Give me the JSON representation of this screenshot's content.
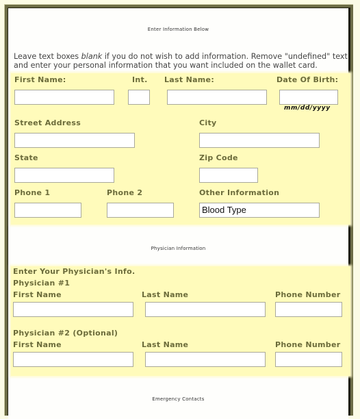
{
  "sections": {
    "personal_title": "Enter Information Below",
    "physician_title": "Physician Information",
    "emergency_title": "Emergency Contacts"
  },
  "intro": {
    "before": "Leave text boxes ",
    "emphasis": "blank",
    "after": " if you do not wish to add information. Remove \"undefined\" text and enter your personal information that you want included on the wallet card."
  },
  "personal": {
    "first_name": {
      "label": "First Name:",
      "value": ""
    },
    "initial": {
      "label": "Int.",
      "value": ""
    },
    "last_name": {
      "label": "Last Name:",
      "value": ""
    },
    "dob": {
      "label": "Date Of Birth:",
      "value": "",
      "hint": "mm/dd/yyyy"
    },
    "street": {
      "label": "Street Address",
      "value": ""
    },
    "city": {
      "label": "City",
      "value": ""
    },
    "state": {
      "label": "State",
      "value": ""
    },
    "zip": {
      "label": "Zip Code",
      "value": ""
    },
    "phone1": {
      "label": "Phone 1",
      "value": ""
    },
    "phone2": {
      "label": "Phone 2",
      "value": ""
    },
    "other": {
      "label": "Other Information",
      "value": "Blood Type"
    }
  },
  "physicians": {
    "heading": "Enter Your Physician's Info.",
    "p1": {
      "title": "Physician #1",
      "first_label": "First Name",
      "first_value": "",
      "last_label": "Last Name",
      "last_value": "",
      "phone_label": "Phone Number",
      "phone_value": ""
    },
    "p2": {
      "title": "Physician #2 (Optional)",
      "first_label": "First Name",
      "first_value": "",
      "last_label": "Last Name",
      "last_value": "",
      "phone_label": "Phone Number",
      "phone_value": ""
    }
  }
}
